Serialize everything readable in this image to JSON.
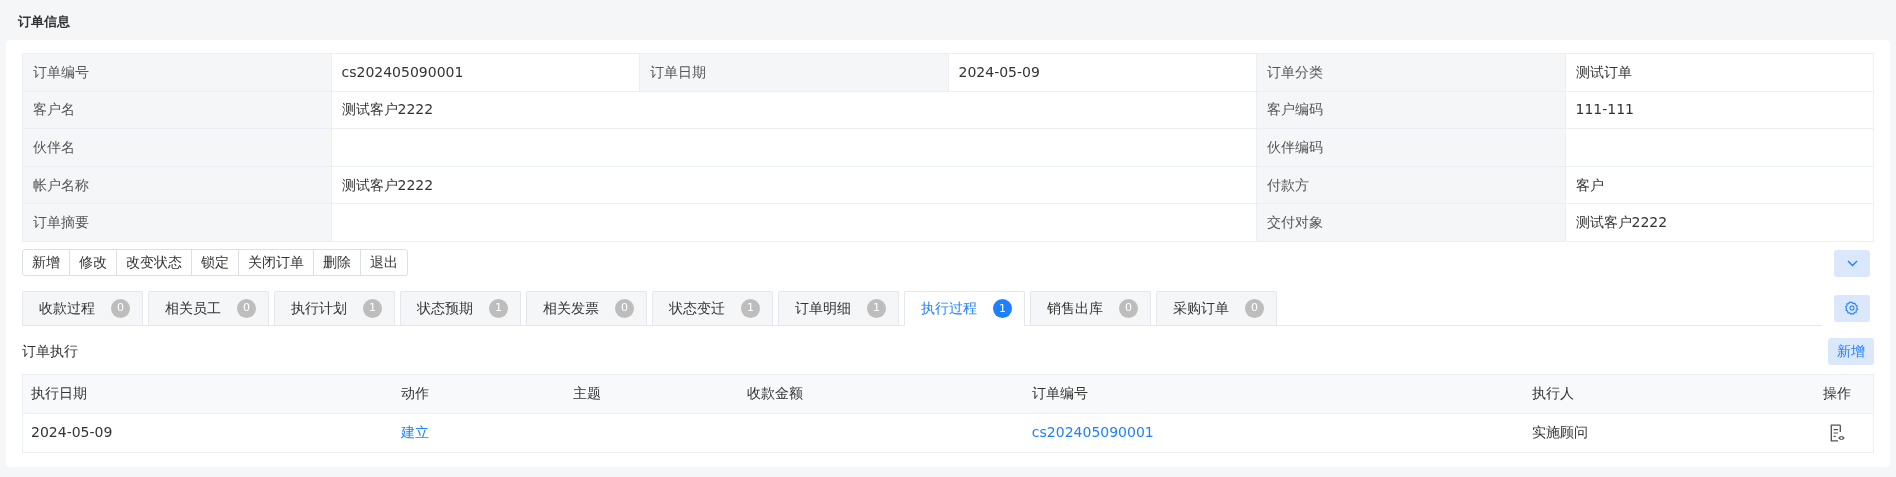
{
  "section_title": "订单信息",
  "info_rows": [
    {
      "cells": [
        {
          "label": "订单编号",
          "value": "cs202405090001"
        },
        {
          "label": "订单日期",
          "value": "2024-05-09"
        },
        {
          "label": "订单分类",
          "value": "测试订单"
        }
      ]
    },
    {
      "cells": [
        {
          "label": "客户名",
          "value": "测试客户2222"
        },
        {
          "label": "客户编码",
          "value": "111-111"
        }
      ]
    },
    {
      "cells": [
        {
          "label": "伙伴名"
        },
        {
          "label": "伙伴编码"
        }
      ]
    },
    {
      "cells": [
        {
          "label": "帐户名称",
          "value": "测试客户2222"
        },
        {
          "label": "付款方",
          "value": "客户"
        }
      ]
    },
    {
      "cells": [
        {
          "label": "订单摘要"
        },
        {
          "label": "交付对象",
          "value": "测试客户2222"
        }
      ]
    }
  ],
  "toolbar": [
    "新增",
    "修改",
    "改变状态",
    "锁定",
    "关闭订单",
    "删除",
    "退出"
  ],
  "tabs": [
    {
      "label": "收款过程",
      "count": "0",
      "selected": false
    },
    {
      "label": "相关员工",
      "count": "0",
      "selected": false
    },
    {
      "label": "执行计划",
      "count": "1",
      "selected": false
    },
    {
      "label": "状态预期",
      "count": "1",
      "selected": false
    },
    {
      "label": "相关发票",
      "count": "0",
      "selected": false
    },
    {
      "label": "状态变迁",
      "count": "1",
      "selected": false
    },
    {
      "label": "订单明细",
      "count": "1",
      "selected": false
    },
    {
      "label": "执行过程",
      "count": "1",
      "selected": true
    },
    {
      "label": "销售出库",
      "count": "0",
      "selected": false
    },
    {
      "label": "采购订单",
      "count": "0",
      "selected": false
    }
  ],
  "panel": {
    "title": "订单执行",
    "add_button": "新增",
    "columns": [
      "执行日期",
      "动作",
      "主题",
      "收款金额",
      "订单编号",
      "执行人",
      "操作"
    ],
    "rows": [
      {
        "cells": [
          {
            "kind": "text",
            "text": "2024-05-09"
          },
          {
            "kind": "link",
            "text": "建立"
          },
          {
            "kind": "empty"
          },
          {
            "kind": "empty"
          },
          {
            "kind": "link",
            "text": "cs202405090001"
          },
          {
            "kind": "text",
            "text": "实施顾问"
          },
          {
            "kind": "view"
          }
        ]
      }
    ]
  }
}
